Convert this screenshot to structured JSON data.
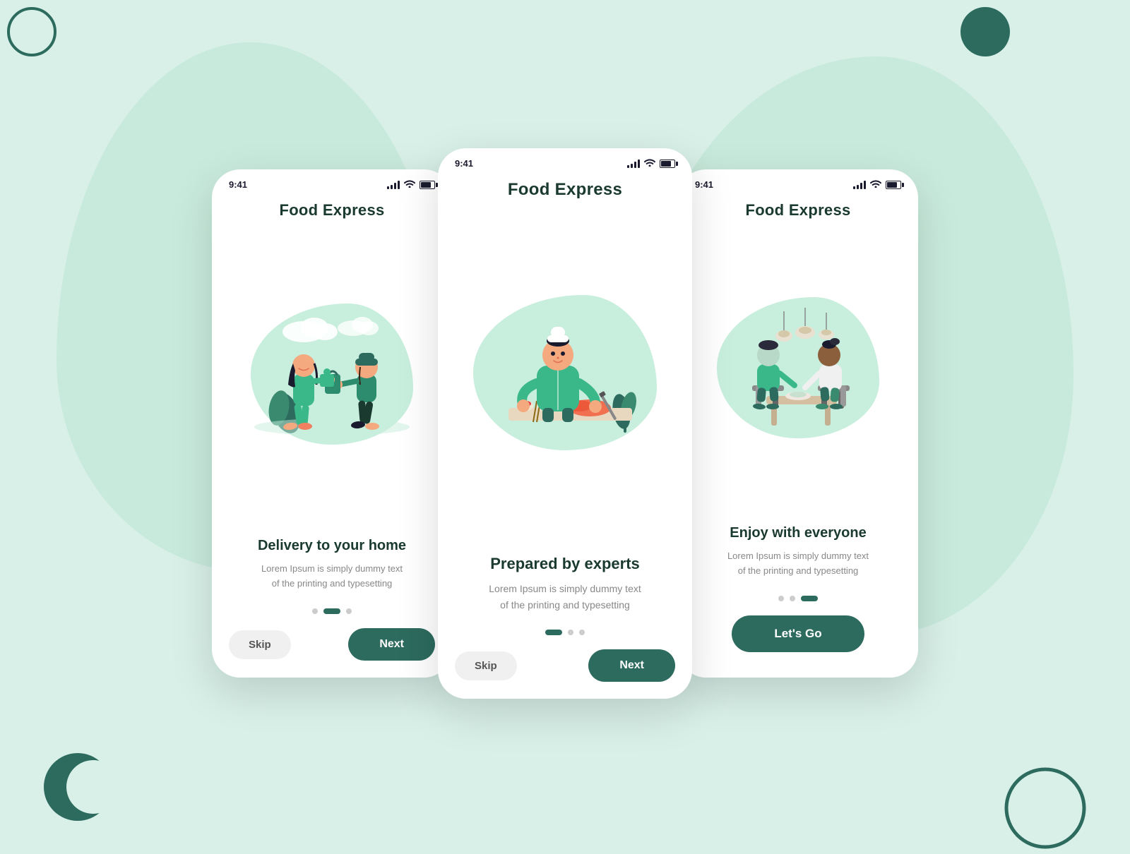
{
  "background": {
    "color": "#d8f0e8"
  },
  "phone1": {
    "status_time": "9:41",
    "title": "Food Express",
    "slide_title": "Delivery to  your home",
    "slide_desc": "Lorem Ipsum is simply dummy text\nof the printing and typesetting",
    "dots": [
      "inactive",
      "active",
      "inactive"
    ],
    "btn_skip": "Skip",
    "btn_next": "Next"
  },
  "phone2": {
    "status_time": "9:41",
    "title": "Food Express",
    "slide_title": "Prepared by experts",
    "slide_desc": "Lorem Ipsum is simply dummy text\nof the printing and typesetting",
    "dots": [
      "active",
      "inactive",
      "inactive"
    ],
    "btn_skip": "Skip",
    "btn_next": "Next"
  },
  "phone3": {
    "status_time": "9:41",
    "title": "Food Express",
    "slide_title": "Enjoy with everyone",
    "slide_desc": "Lorem Ipsum is simply dummy text\nof the printing and typesetting",
    "dots": [
      "inactive",
      "inactive",
      "active"
    ],
    "btn_lets_go": "Let's Go"
  }
}
